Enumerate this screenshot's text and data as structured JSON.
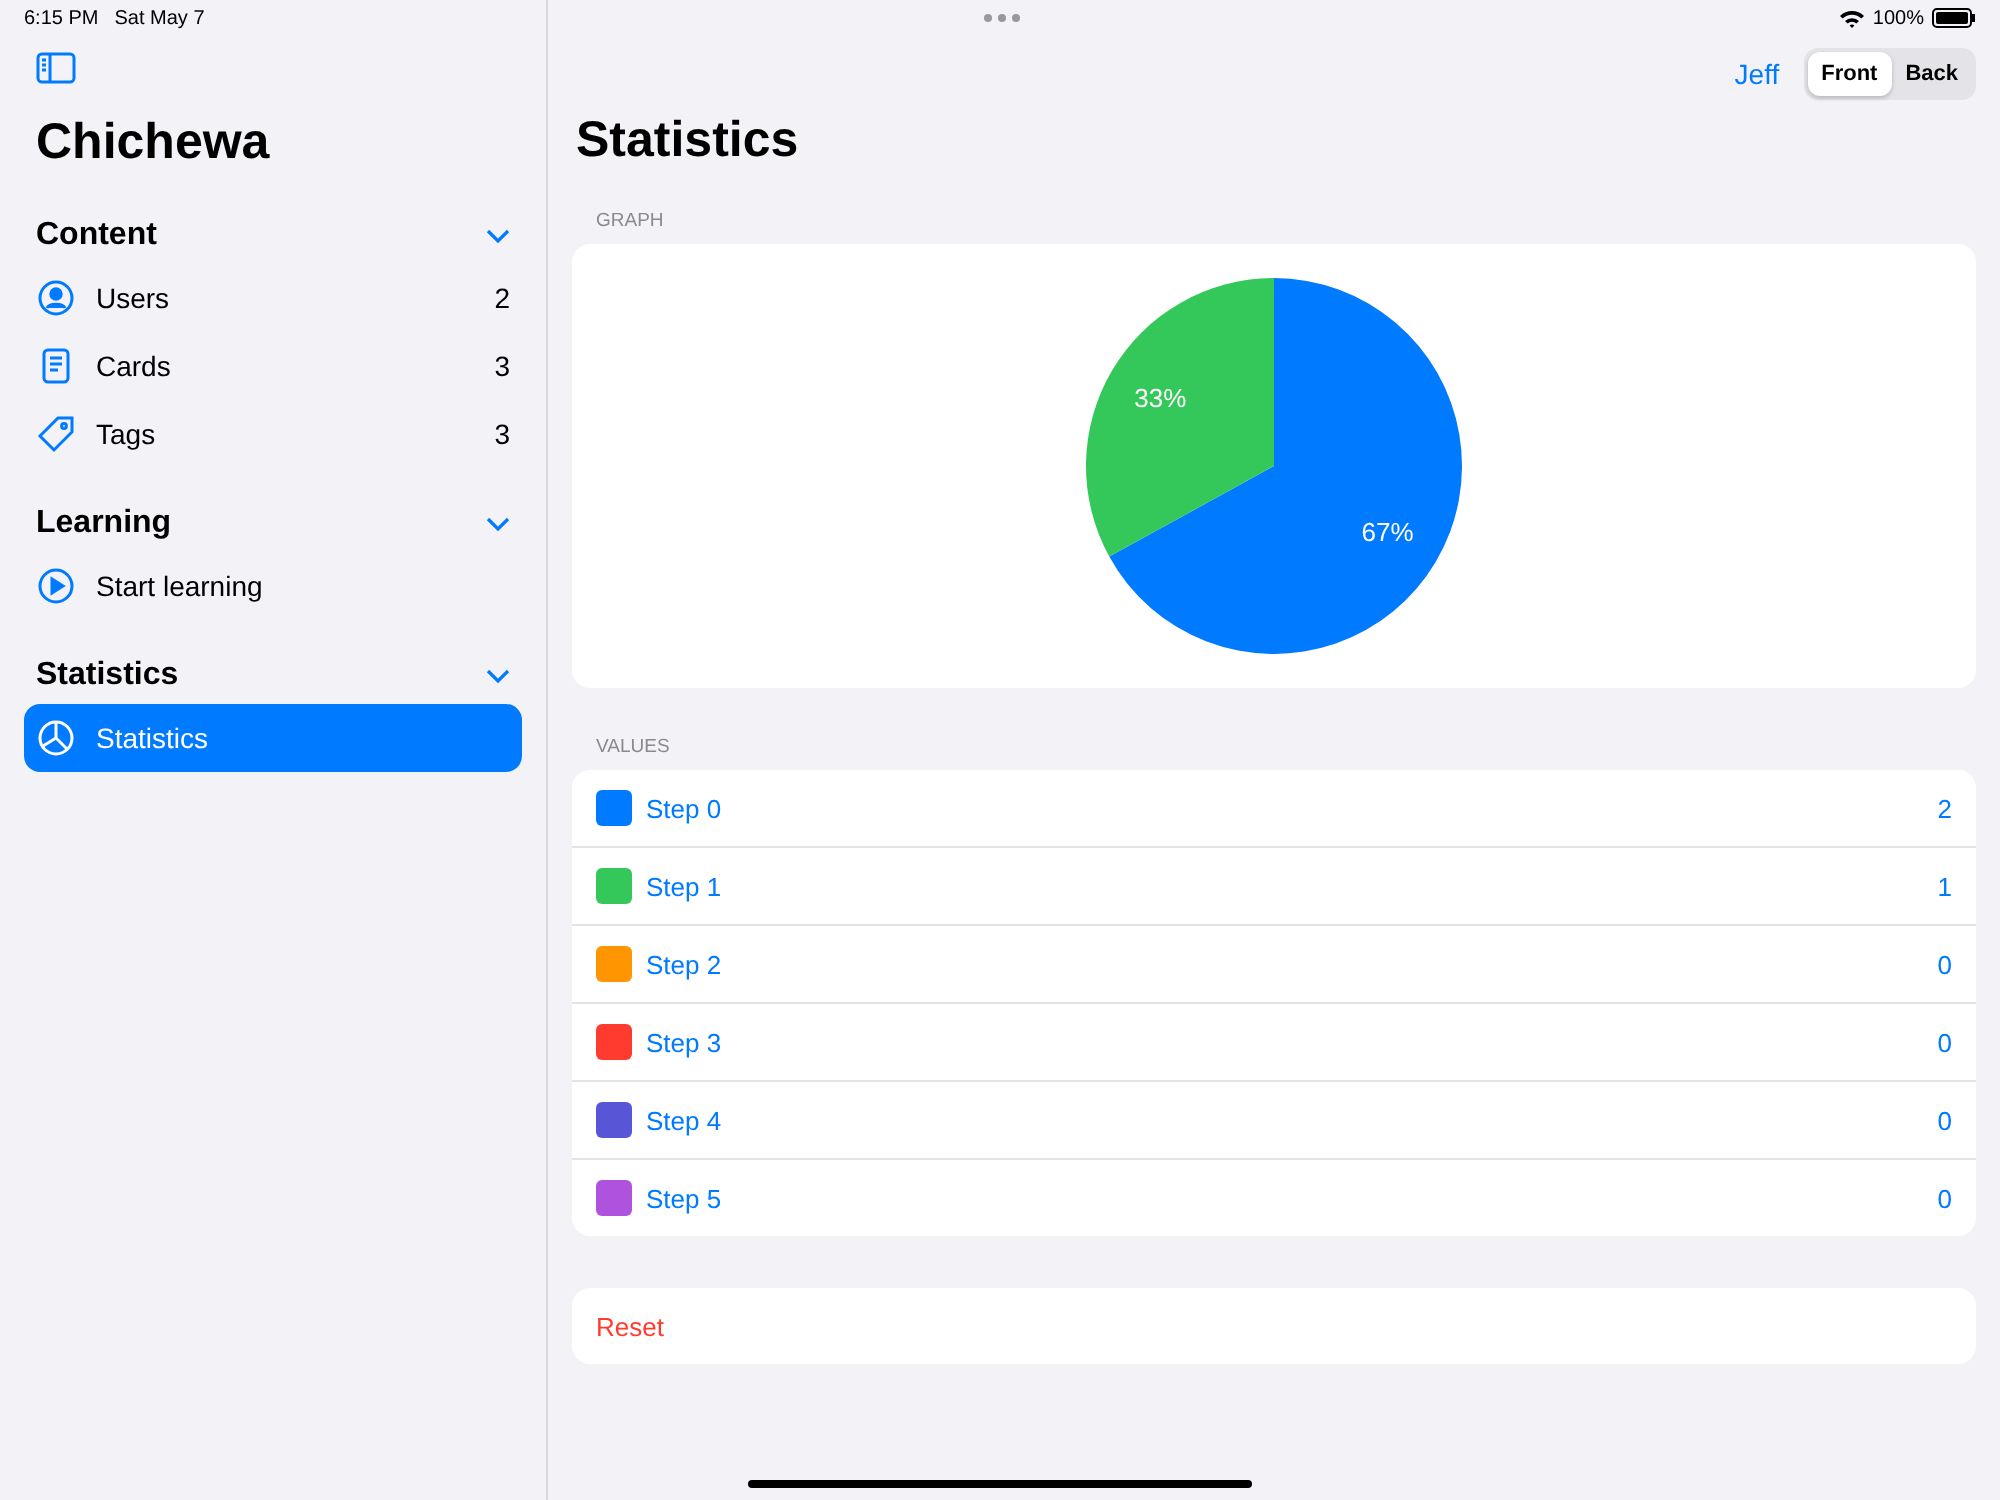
{
  "status_bar": {
    "time": "6:15 PM",
    "date": "Sat May 7",
    "battery": "100%"
  },
  "sidebar": {
    "title": "Chichewa",
    "sections": [
      {
        "title": "Content",
        "expanded": true,
        "items": [
          {
            "kind": "users",
            "label": "Users",
            "count": "2",
            "selected": false
          },
          {
            "kind": "cards",
            "label": "Cards",
            "count": "3",
            "selected": false
          },
          {
            "kind": "tags",
            "label": "Tags",
            "count": "3",
            "selected": false
          }
        ]
      },
      {
        "title": "Learning",
        "expanded": true,
        "items": [
          {
            "kind": "play",
            "label": "Start learning",
            "selected": false
          }
        ]
      },
      {
        "title": "Statistics",
        "expanded": true,
        "items": [
          {
            "kind": "chart",
            "label": "Statistics",
            "selected": true
          }
        ]
      }
    ]
  },
  "toolbar": {
    "user": "Jeff",
    "segments": [
      {
        "label": "Front",
        "selected": true
      },
      {
        "label": "Back",
        "selected": false
      }
    ]
  },
  "page_title": "Statistics",
  "graph": {
    "header": "GRAPH",
    "chart_data": {
      "type": "pie",
      "values": [
        67,
        33
      ],
      "value_labels": [
        "67%",
        "33%"
      ]
    }
  },
  "values": {
    "header": "VALUES",
    "rows": [
      {
        "label": "Step 0",
        "value": "2",
        "color": "#007aff"
      },
      {
        "label": "Step 1",
        "value": "1",
        "color": "#34c759"
      },
      {
        "label": "Step 2",
        "value": "0",
        "color": "#ff9500"
      },
      {
        "label": "Step 3",
        "value": "0",
        "color": "#ff3b30"
      },
      {
        "label": "Step 4",
        "value": "0",
        "color": "#5856d6"
      },
      {
        "label": "Step 5",
        "value": "0",
        "color": "#af52de"
      }
    ]
  },
  "reset": "Reset"
}
